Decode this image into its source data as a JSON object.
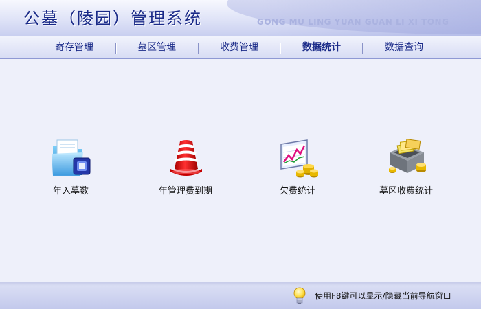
{
  "header": {
    "title": "公墓（陵园）管理系统",
    "subtitle": "GONG MU LING YUAN GUAN LI XI TONG"
  },
  "nav": {
    "items": [
      {
        "label": "寄存管理"
      },
      {
        "label": "墓区管理"
      },
      {
        "label": "收费管理"
      },
      {
        "label": "数据统计",
        "active": true
      },
      {
        "label": "数据查询"
      }
    ]
  },
  "main": {
    "items": [
      {
        "label": "年入墓数",
        "icon": "folder-icon"
      },
      {
        "label": "年管理费到期",
        "icon": "bell-icon"
      },
      {
        "label": "欠费统计",
        "icon": "chart-coins-icon"
      },
      {
        "label": "墓区收费统计",
        "icon": "money-box-icon"
      }
    ]
  },
  "status": {
    "text": "使用F8键可以显示/隐藏当前导航窗口",
    "icon": "lightbulb-icon"
  },
  "colors": {
    "title": "#1a2a88",
    "accent": "#8f99d4",
    "background": "#eef0fa"
  }
}
